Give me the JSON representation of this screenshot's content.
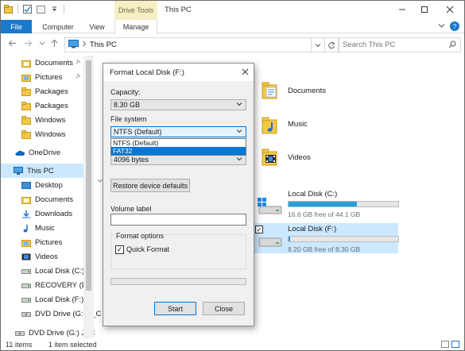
{
  "titlebar": {
    "context_tab": "Drive Tools",
    "title": "This PC"
  },
  "ribbon": {
    "tabs": [
      "File",
      "Computer",
      "View",
      "Manage"
    ]
  },
  "address": {
    "path": "This PC",
    "search_placeholder": "Search This PC"
  },
  "sidebar": {
    "items": [
      {
        "label": "Documents",
        "icon": "documents-folder-icon",
        "pinned": true
      },
      {
        "label": "Pictures",
        "icon": "pictures-folder-icon",
        "pinned": true
      },
      {
        "label": "Packages",
        "icon": "folder-icon"
      },
      {
        "label": "Packages",
        "icon": "folder-icon"
      },
      {
        "label": "Windows",
        "icon": "folder-icon"
      },
      {
        "label": "Windows",
        "icon": "folder-icon"
      },
      {
        "label": "OneDrive",
        "icon": "onedrive-cloud-icon"
      },
      {
        "label": "This PC",
        "icon": "computer-icon",
        "selected": true
      },
      {
        "label": "Desktop",
        "icon": "desktop-folder-icon"
      },
      {
        "label": "Documents",
        "icon": "documents-folder-icon"
      },
      {
        "label": "Downloads",
        "icon": "downloads-folder-icon"
      },
      {
        "label": "Music",
        "icon": "music-folder-icon"
      },
      {
        "label": "Pictures",
        "icon": "pictures-folder-icon"
      },
      {
        "label": "Videos",
        "icon": "videos-folder-icon"
      },
      {
        "label": "Local Disk (C:)",
        "icon": "drive-icon"
      },
      {
        "label": "RECOVERY (D:)",
        "icon": "drive-icon"
      },
      {
        "label": "Local Disk (F:)",
        "icon": "drive-icon"
      },
      {
        "label": "DVD Drive (G:) J_C",
        "icon": "dvd-drive-icon"
      },
      {
        "label": "DVD Drive (G:) J_C",
        "icon": "dvd-drive-icon"
      }
    ]
  },
  "main": {
    "folders": [
      {
        "label": "Documents",
        "icon": "documents-folder-icon"
      },
      {
        "label": "Music",
        "icon": "music-folder-icon"
      },
      {
        "label": "Videos",
        "icon": "videos-folder-icon"
      }
    ],
    "drives": [
      {
        "name": "Local Disk (C:)",
        "free": "16.6 GB free of 44.1 GB",
        "used_fraction": 0.62
      },
      {
        "name": "Local Disk (F:)",
        "free": "8.20 GB free of 8.30 GB",
        "used_fraction": 0.012,
        "selected": true,
        "checked": true
      }
    ]
  },
  "status": {
    "count": "11 items",
    "selection": "1 item selected"
  },
  "dialog": {
    "title": "Format Local Disk (F:)",
    "capacity_label": "Capacity:",
    "capacity_value": "8.30 GB",
    "fs_label": "File system",
    "fs_value": "NTFS (Default)",
    "fs_options": [
      "NTFS (Default)",
      "FAT32"
    ],
    "fs_highlighted": "FAT32",
    "alloc_value": "4096 bytes",
    "restore_label": "Restore device defaults",
    "volume_label": "Volume label",
    "volume_value": "",
    "format_options_label": "Format options",
    "quick_format_label": "Quick Format",
    "quick_format_checked": true,
    "start_label": "Start",
    "close_label": "Close"
  },
  "colors": {
    "accent": "#0078d7",
    "file_tab": "#1979ca",
    "selection": "#cce8ff",
    "context_tab_bg": "#f6efc4",
    "drive_bar": "#26a0da",
    "folder_yellow": "#f3c845"
  }
}
